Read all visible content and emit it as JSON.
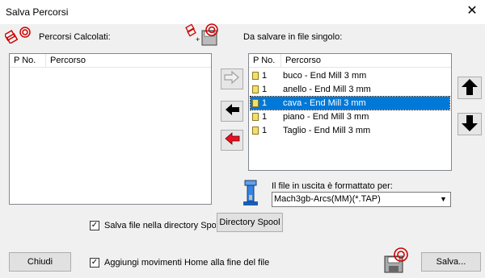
{
  "window": {
    "title": "Salva Percorsi",
    "close_glyph": "✕"
  },
  "left_panel": {
    "label": "Percorsi Calcolati:",
    "columns": [
      "P No.",
      "Percorso"
    ]
  },
  "right_panel": {
    "label": "Da salvare in file singolo:",
    "columns": [
      "P No.",
      "Percorso"
    ],
    "rows": [
      {
        "no": "1",
        "name": "buco - End Mill 3 mm",
        "selected": false
      },
      {
        "no": "1",
        "name": "anello - End Mill 3 mm",
        "selected": false
      },
      {
        "no": "1",
        "name": "cava - End Mill 3 mm",
        "selected": true
      },
      {
        "no": "1",
        "name": "piano - End Mill 3 mm",
        "selected": false
      },
      {
        "no": "1",
        "name": "Taglio - End Mill 3 mm",
        "selected": false
      }
    ]
  },
  "format": {
    "label": "Il file in uscita è formattato per:",
    "selected": "Mach3gb-Arcs(MM)(*.TAP)"
  },
  "options": {
    "spool_label": "Salva file nella directory Spoo",
    "spool_checked": true,
    "home_label": "Aggiungi movimenti Home alla fine del file",
    "home_checked": true,
    "check_glyph": "✓"
  },
  "buttons": {
    "directory_spool": "Directory Spool",
    "close": "Chiudi",
    "save": "Salva..."
  },
  "colors": {
    "selection": "#0078d7",
    "accent_red": "#e81123"
  }
}
